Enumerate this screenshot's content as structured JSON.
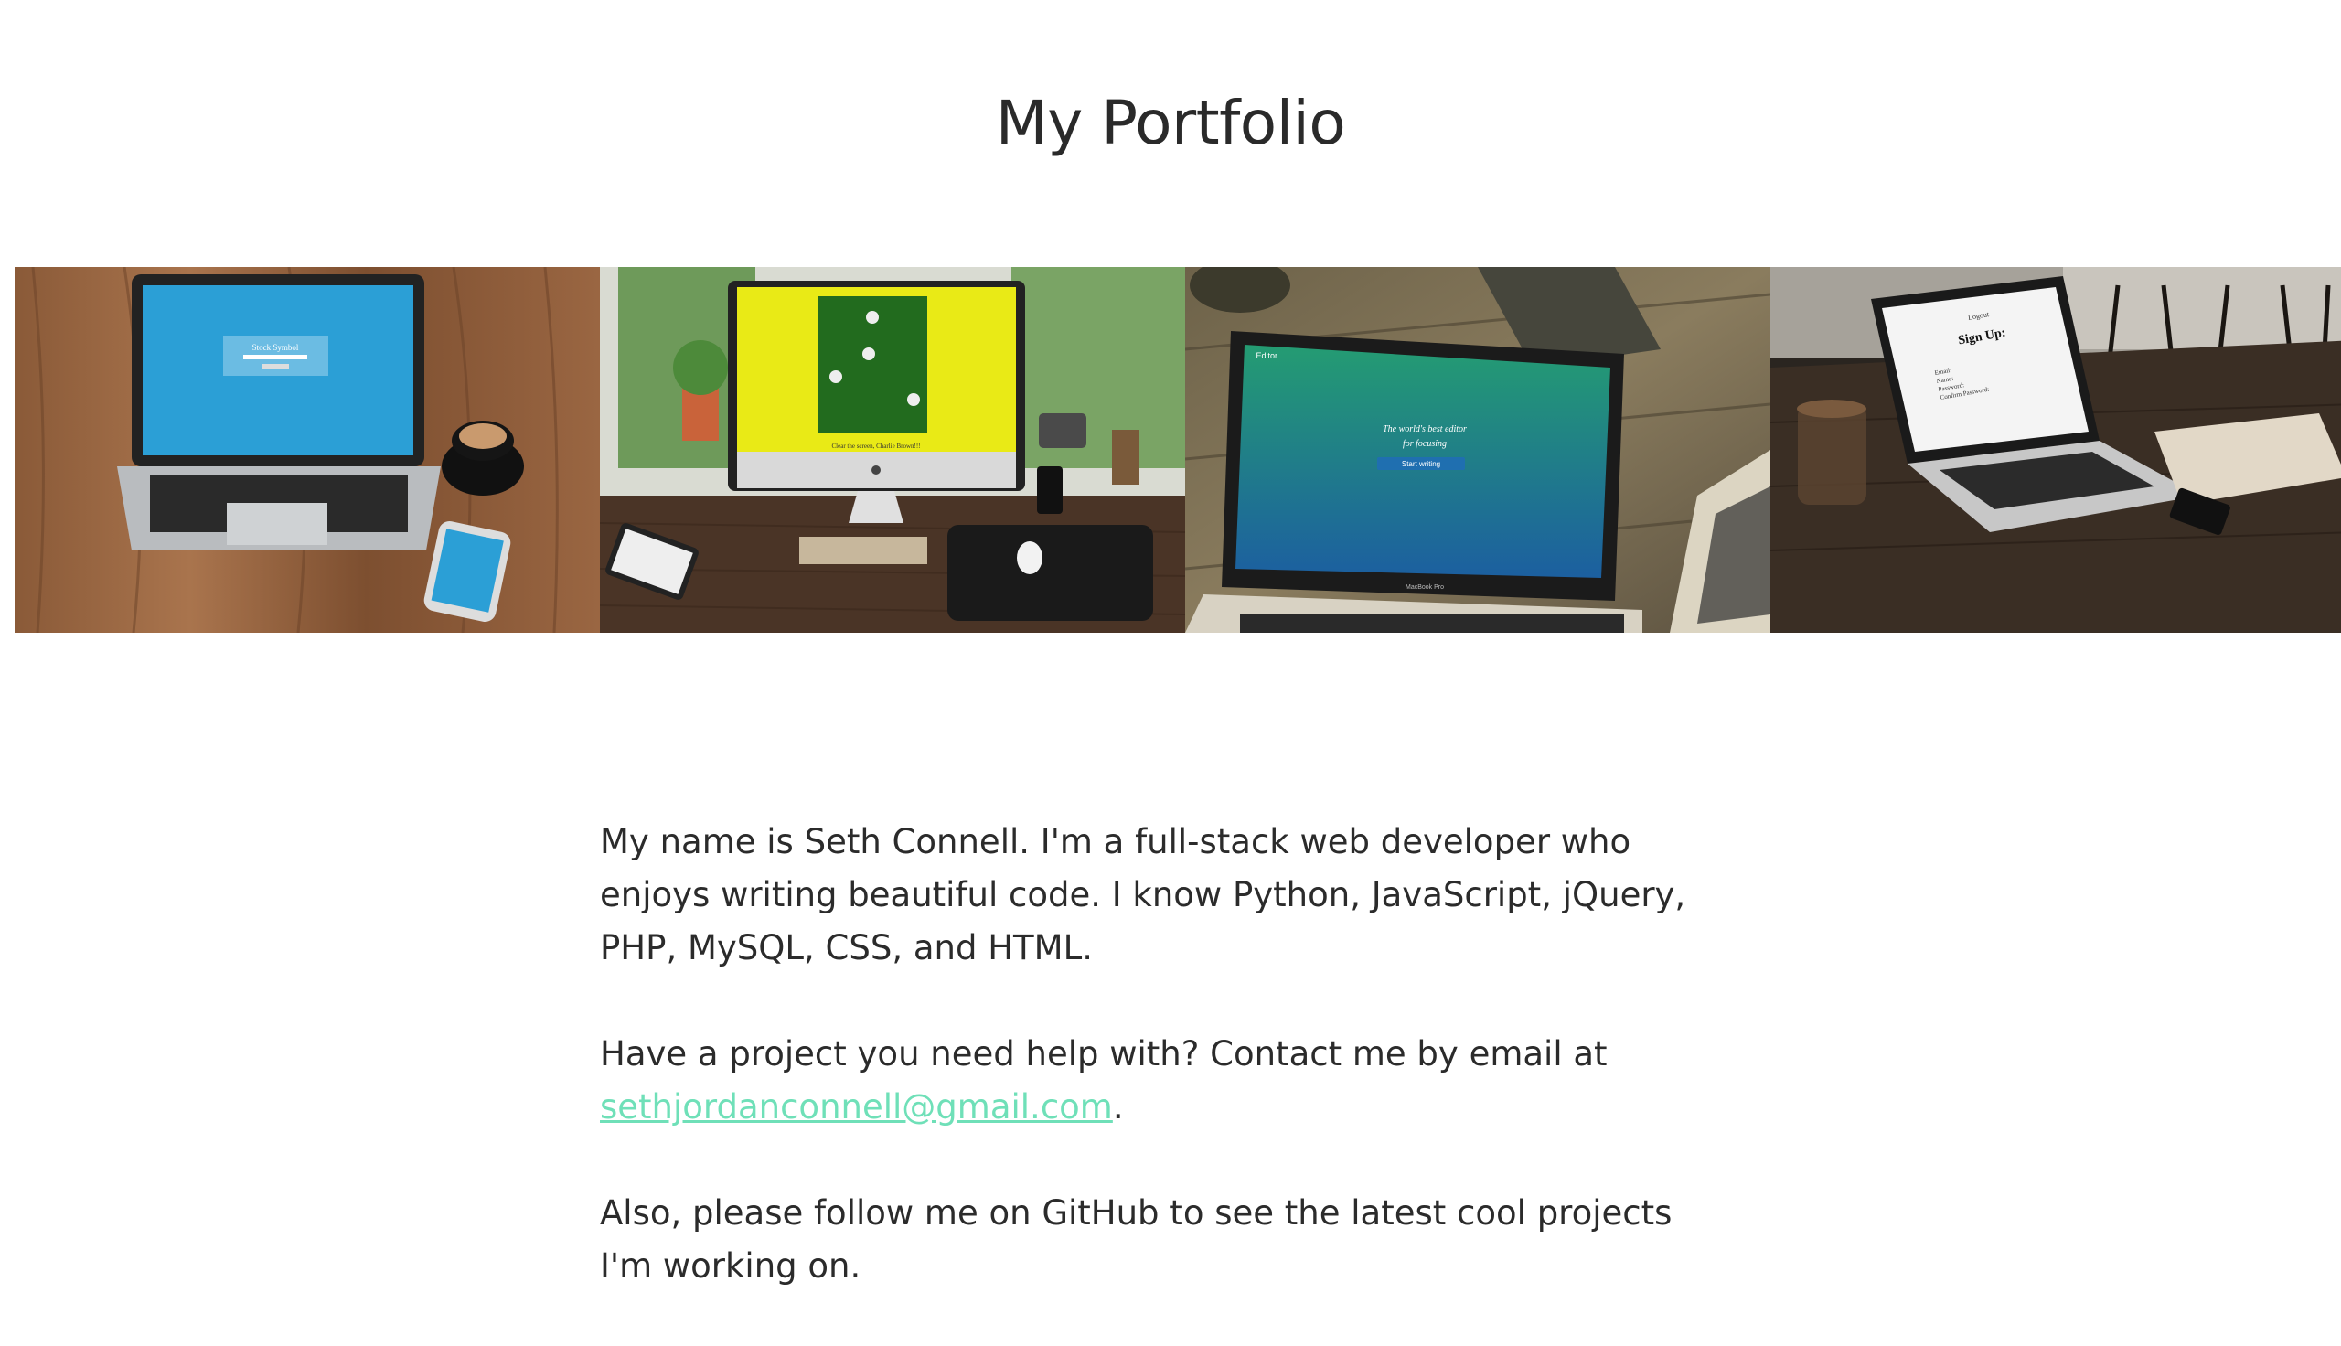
{
  "page": {
    "title": "My Portfolio"
  },
  "gallery": {
    "items": [
      {
        "name": "stock-app",
        "screen_title": "Stock Symbol"
      },
      {
        "name": "charlie-brown-game",
        "screen_caption": "Clear the screen, Charlie Brown!!!"
      },
      {
        "name": "text-editor",
        "screen_title": "...Editor",
        "screen_lines": [
          "The world's best editor",
          "for focusing"
        ],
        "screen_button": "Start writing",
        "laptop_model": "MacBook Pro"
      },
      {
        "name": "signup-app",
        "screen_link": "Logout",
        "screen_title": "Sign Up:",
        "screen_fields": [
          "Email:",
          "Name:",
          "Password:",
          "Confirm Password:"
        ]
      }
    ]
  },
  "bio": {
    "intro": "My name is Seth Connell. I'm a full-stack web developer who enjoys writing beautiful code. I know Python, JavaScript, jQuery, PHP, MySQL, CSS, and HTML.",
    "contact_prefix": "Have a project you need help with? Contact me by email at",
    "email": "sethjordanconnell@gmail.com",
    "contact_suffix": ".",
    "github": "Also, please follow me on GitHub to see the latest cool projects I'm working on."
  },
  "colors": {
    "link": "#6fe0b8",
    "text": "#2b2b2b"
  }
}
